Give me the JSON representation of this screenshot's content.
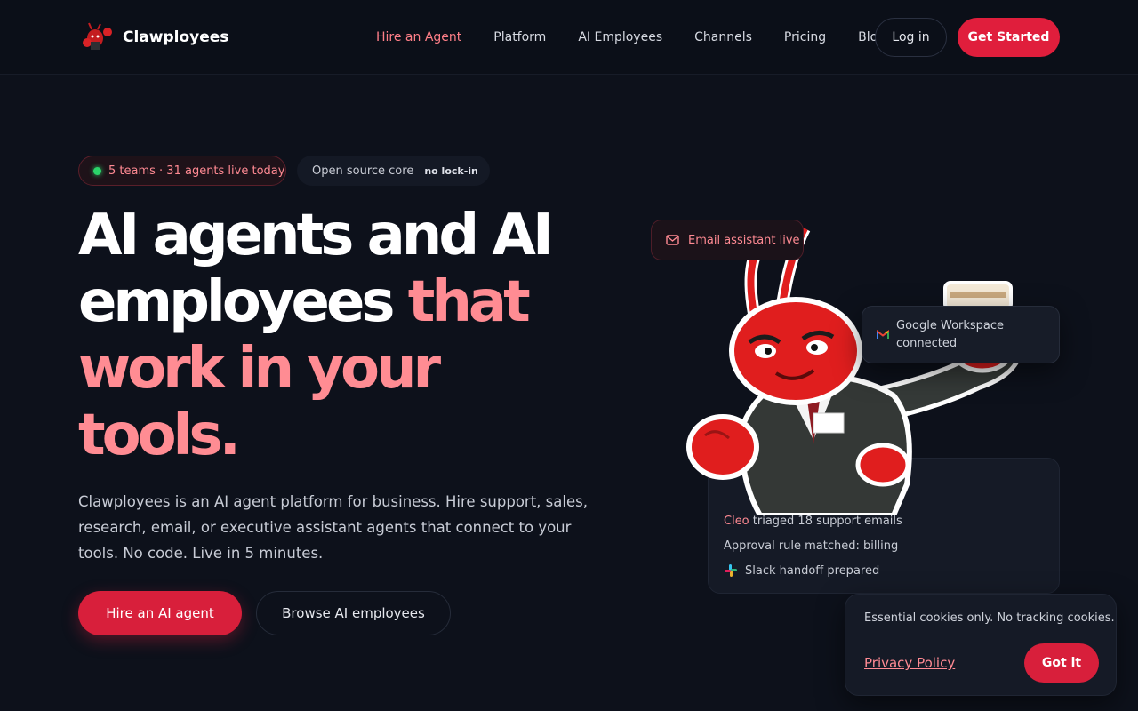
{
  "brand": {
    "name": "Clawployees",
    "logo_icon": "lobster-mascot-icon"
  },
  "nav": {
    "items": [
      {
        "label": "Hire an Agent",
        "active": true
      },
      {
        "label": "Platform"
      },
      {
        "label": "AI Employees"
      },
      {
        "label": "Channels"
      },
      {
        "label": "Pricing"
      },
      {
        "label": "Blog"
      }
    ],
    "login_label": "Log in",
    "get_started_label": "Get Started"
  },
  "badges": {
    "live": "5 teams · 31 agents live today",
    "open_source": "Open source core",
    "no_lockin": "no lock-in"
  },
  "hero": {
    "line1": "AI agents and AI",
    "line2_a": "employees",
    "line2_b": "that",
    "line3": "work in your",
    "line4": "tools."
  },
  "description": "Clawployees is an AI agent platform for business. Hire support, sales, research, email, or executive assistant agents that connect to your tools. No code. Live in 5 minutes.",
  "cta": {
    "primary": "Hire an AI agent",
    "secondary": "Browse AI employees"
  },
  "cards": {
    "email": "Email assistant live",
    "google": "Google Workspace connected",
    "activity": {
      "name": "Cleo",
      "line1_rest": "triaged 18 support emails",
      "line2": "Approval rule matched: billing",
      "line3": "Slack handoff prepared"
    }
  },
  "cookie": {
    "message": "Essential cookies only. No tracking cookies.",
    "privacy": "Privacy Policy",
    "button": "Got it"
  },
  "colors": {
    "accent": "#ff8c93",
    "brand_red": "#e01e3c",
    "background": "#0d111b",
    "live_dot": "#2bd46a"
  }
}
